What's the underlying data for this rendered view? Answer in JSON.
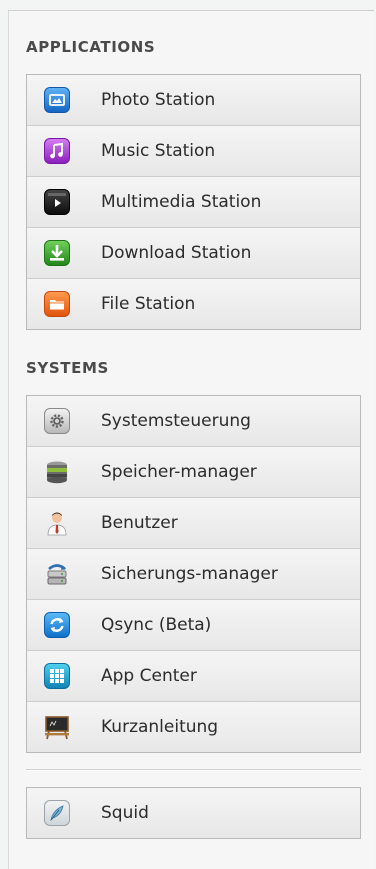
{
  "applications": {
    "title": "APPLICATIONS",
    "items": [
      {
        "label": "Photo Station",
        "icon": "photo-icon",
        "color": "#1e7fd6"
      },
      {
        "label": "Music Station",
        "icon": "music-note-icon",
        "color": "#9b2fc9"
      },
      {
        "label": "Multimedia Station",
        "icon": "play-icon",
        "color": "#111111"
      },
      {
        "label": "Download Station",
        "icon": "download-arrow-icon",
        "color": "#3aa32a"
      },
      {
        "label": "File Station",
        "icon": "folder-icon",
        "color": "#ef6b1f"
      }
    ]
  },
  "systems": {
    "title": "SYSTEMS",
    "items": [
      {
        "label": "Systemsteuerung",
        "icon": "gear-icon",
        "color": "#8a8a8a"
      },
      {
        "label": "Speicher-manager",
        "icon": "storage-disk-icon",
        "color": "#5a8f2a"
      },
      {
        "label": "Benutzer",
        "icon": "user-icon",
        "color": "#c0392b"
      },
      {
        "label": "Sicherungs-manager",
        "icon": "backup-icon",
        "color": "#2d6fb3"
      },
      {
        "label": "Qsync (Beta)",
        "icon": "sync-icon",
        "color": "#1d8be0"
      },
      {
        "label": "App Center",
        "icon": "app-grid-icon",
        "color": "#1a9cc7"
      },
      {
        "label": "Kurzanleitung",
        "icon": "chalkboard-icon",
        "color": "#2a2a2a"
      }
    ]
  },
  "extras": {
    "items": [
      {
        "label": "Squid",
        "icon": "feather-icon",
        "color": "#6a9fc0"
      }
    ]
  }
}
